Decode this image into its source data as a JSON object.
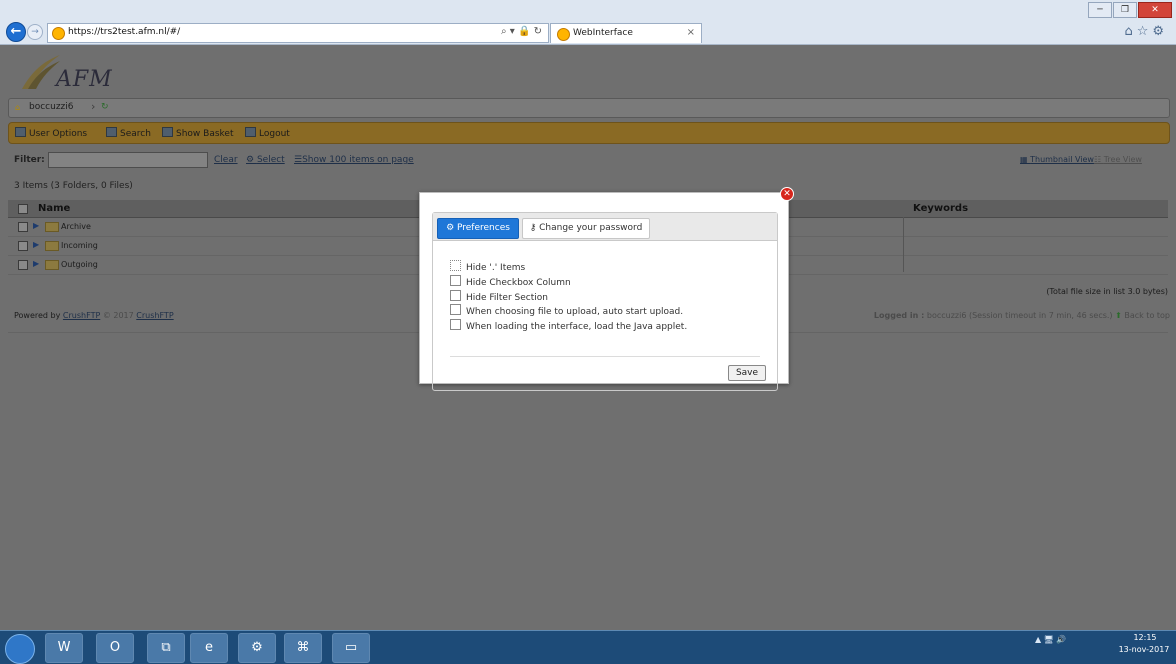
{
  "browser": {
    "url": "https://trs2test.afm.nl/#/",
    "tab_title": "WebInterface",
    "tab_close": "×",
    "address_icons": "⌕ ▾ 🔒 ↻",
    "window_controls": [
      "─",
      "❐",
      "✕"
    ],
    "tools": "⌂☆⚙"
  },
  "page": {
    "logo": "AFM",
    "breadcrumb": {
      "user": "boccuzzi6"
    },
    "toolbar": {
      "user_options": "User Options",
      "search": "Search",
      "show_basket": "Show Basket",
      "logout": "Logout"
    },
    "filter": {
      "label": "Filter:",
      "value": "",
      "clear": "Clear",
      "select": "Select",
      "show_100": "Show 100 items on page",
      "thumbnail_view": "Thumbnail View",
      "tree_view": "Tree View"
    },
    "items_count": "3 Items (3 Folders, 0 Files)",
    "table": {
      "headers": {
        "name": "Name",
        "keywords": "Keywords"
      },
      "rows": [
        {
          "name": "Archive"
        },
        {
          "name": "Incoming"
        },
        {
          "name": "Outgoing"
        }
      ]
    },
    "total_size": "(Total file size in list 3.0 bytes)",
    "footer": {
      "powered_prefix": "Powered by",
      "crushftp": "CrushFTP",
      "copyright": "© 2017",
      "crushftp2": "CrushFTP",
      "logged_in_label": "Logged in :",
      "logged_in_text": "boccuzzi6 (Session timeout in 7 min, 46 secs.)",
      "back_to_top": "Back to top"
    }
  },
  "modal": {
    "close": "✕",
    "tabs": {
      "preferences": "Preferences",
      "change_password": "Change your password"
    },
    "options": [
      "Hide '.' Items",
      "Hide Checkbox Column",
      "Hide Filter Section",
      "When choosing file to upload, auto start upload.",
      "When loading the interface, load the Java applet."
    ],
    "save": "Save"
  },
  "taskbar": {
    "apps": [
      "W",
      "O",
      "⧉",
      "e",
      "⚙",
      "⌘",
      "▭"
    ],
    "tray": "▲ 🖥 🔊",
    "time": "12:15",
    "date": "13-nov-2017"
  }
}
